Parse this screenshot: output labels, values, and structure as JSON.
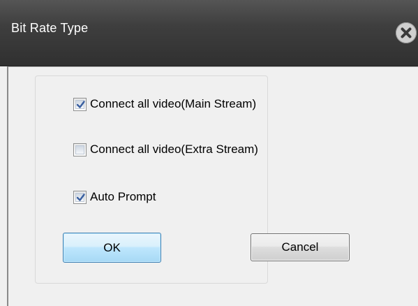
{
  "window": {
    "title": "Bit Rate Type",
    "close_icon": "close-circle-x-icon"
  },
  "options": [
    {
      "label": "Connect all video(Main Stream)",
      "checked": true
    },
    {
      "label": "Connect all video(Extra Stream)",
      "checked": false
    },
    {
      "label": "Auto Prompt",
      "checked": true
    }
  ],
  "buttons": {
    "ok_label": "OK",
    "cancel_label": "Cancel"
  },
  "colors": {
    "titlebar": "#3e3e3e",
    "title_text": "#ffffff",
    "dialog_bg": "#f0f0f0",
    "checkmark": "#3a5fa0",
    "ok_border": "#3c7fb1"
  }
}
